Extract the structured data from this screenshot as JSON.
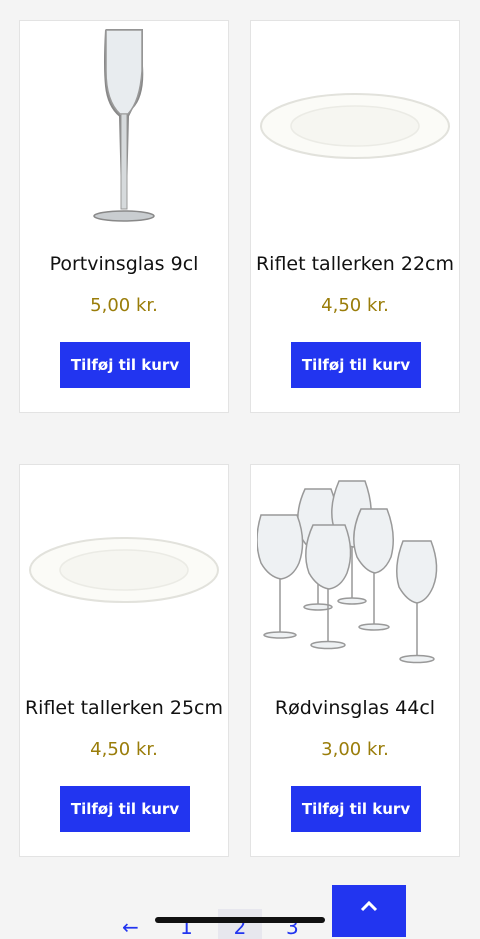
{
  "products": [
    {
      "name": "Portvinsglas 9cl",
      "price": "5,00 kr.",
      "button": "Tilføj til kurv",
      "image": "port-wine-glass"
    },
    {
      "name": "Riflet tallerken 22cm",
      "price": "4,50 kr.",
      "button": "Tilføj til kurv",
      "image": "white-plate"
    },
    {
      "name": "Riflet tallerken 25cm",
      "price": "4,50 kr.",
      "button": "Tilføj til kurv",
      "image": "white-plate"
    },
    {
      "name": "Rødvinsglas 44cl",
      "price": "3,00 kr.",
      "button": "Tilføj til kurv",
      "image": "red-wine-glasses"
    }
  ],
  "pagination": {
    "prev": "←",
    "pages": [
      "1",
      "2",
      "3"
    ],
    "current": "2"
  },
  "colors": {
    "accent": "#2235f0",
    "price": "#9a7d0a",
    "background": "#f4f4f4"
  }
}
